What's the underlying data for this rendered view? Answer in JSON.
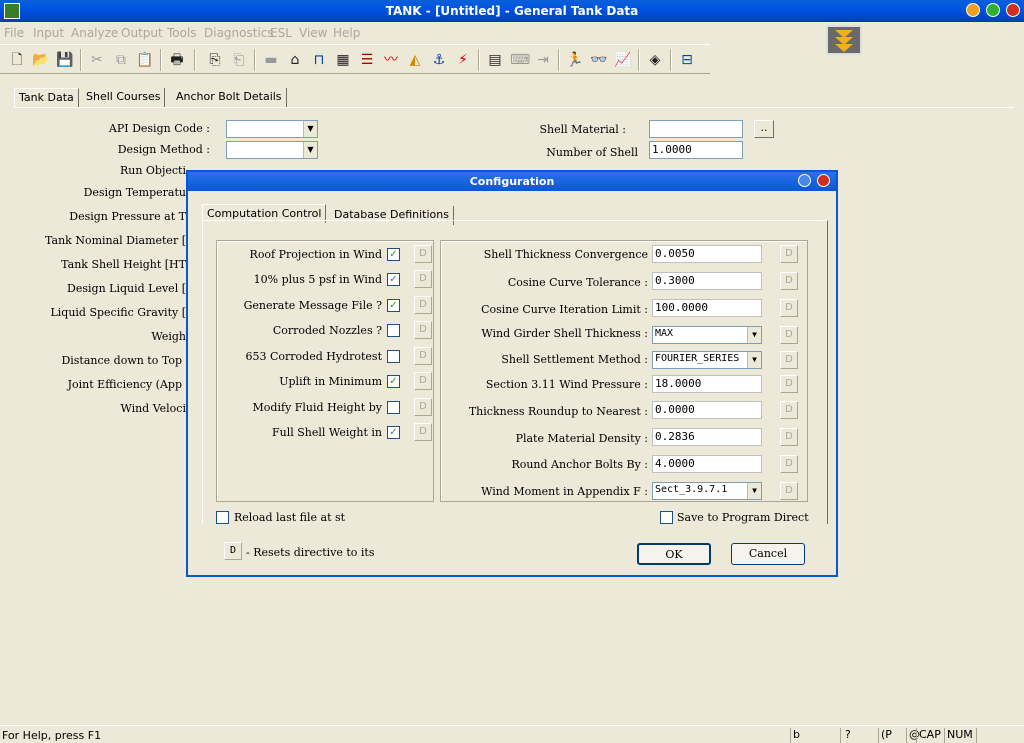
{
  "window": {
    "title": "TANK - [Untitled] - General Tank Data"
  },
  "menu": [
    "File",
    "Input",
    "Analyze",
    "Output",
    "Tools",
    "Diagnostics",
    "ESL",
    "View",
    "Help"
  ],
  "main_tabs": [
    "Tank Data",
    "Shell Courses",
    "Anchor Bolt Details"
  ],
  "left_labels": [
    "API Design Code :",
    "Design Method :",
    "Run Objecti",
    "Design Temperatu",
    "Design Pressure at T",
    "Tank Nominal Diameter [",
    "Tank Shell Height [HT",
    "Design Liquid Level [",
    "Liquid Specific Gravity [",
    "Weigh",
    "Distance down to Top",
    "Joint Efficiency (App",
    "Wind Veloci"
  ],
  "right_fields": {
    "shell_material_label": "Shell Material :",
    "shell_material_value": "",
    "shell_material_btn": "..",
    "num_shell_label": "Number of Shell",
    "num_shell_value": "1.0000"
  },
  "dialog": {
    "title": "Configuration",
    "tabs": [
      "Computation Control",
      "Database Definitions"
    ],
    "checks": [
      {
        "label": "Roof Projection in Wind",
        "checked": "✓"
      },
      {
        "label": "10% plus 5 psf in Wind",
        "checked": "✓"
      },
      {
        "label": "Generate Message File ?",
        "checked": "✓"
      },
      {
        "label": "Corroded Nozzles ?",
        "checked": ""
      },
      {
        "label": "653 Corroded Hydrotest",
        "checked": ""
      },
      {
        "label": "Uplift in Minimum",
        "checked": "✓"
      },
      {
        "label": "Modify Fluid Height by",
        "checked": ""
      },
      {
        "label": "Full Shell Weight in",
        "checked": "✓"
      }
    ],
    "fields": [
      {
        "label": "Shell Thickness Convergence",
        "value": "0.0050",
        "combo": false
      },
      {
        "label": "Cosine Curve Tolerance :",
        "value": "0.3000",
        "combo": false
      },
      {
        "label": "Cosine Curve Iteration Limit :",
        "value": "100.0000",
        "combo": false
      },
      {
        "label": "Wind Girder Shell Thickness :",
        "value": "MAX",
        "combo": true
      },
      {
        "label": "Shell Settlement Method :",
        "value": "FOURIER_SERIES",
        "combo": true
      },
      {
        "label": "Section 3.11 Wind Pressure :",
        "value": "18.0000",
        "combo": false
      },
      {
        "label": "Thickness Roundup to Nearest :",
        "value": "0.0000",
        "combo": false
      },
      {
        "label": "Plate Material Density :",
        "value": "0.2836",
        "combo": false
      },
      {
        "label": "Round Anchor Bolts By :",
        "value": "4.0000",
        "combo": false
      },
      {
        "label": "Wind Moment in Appendix F :",
        "value": "Sect_3.9.7.1",
        "combo": true
      }
    ],
    "d_label": "D",
    "reload_label": "Reload last file at st",
    "save_label": "Save to Program Direct",
    "legend_text": "- Resets directive to its",
    "ok_label": "OK",
    "cancel_label": "Cancel"
  },
  "status": {
    "help": "For Help, press F1",
    "cells": [
      "b",
      "?",
      "(P",
      "@",
      "CAP",
      "NUM",
      ""
    ]
  }
}
